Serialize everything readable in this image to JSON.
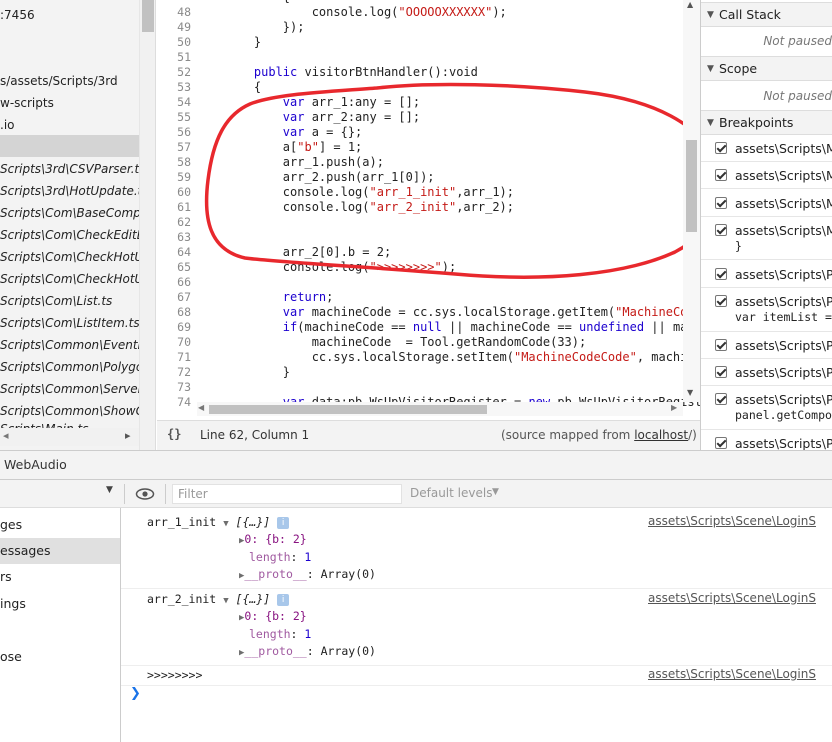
{
  "nav": {
    "rows": [
      ":7456",
      "",
      "",
      "s/assets/Scripts/3rd",
      "w-scripts",
      ".io",
      "",
      "Scripts\\3rd\\CSVParser.ts",
      "Scripts\\3rd\\HotUpdate.ts",
      "Scripts\\Com\\BaseCompo",
      "Scripts\\Com\\CheckEditBo",
      "Scripts\\Com\\CheckHotUp",
      "Scripts\\Com\\CheckHotUp",
      "Scripts\\Com\\List.ts",
      "Scripts\\Com\\ListItem.ts",
      "Scripts\\Common\\EventNo",
      "Scripts\\Common\\Polygor",
      "Scripts\\Common\\ServerC",
      "Scripts\\Common\\ShowGo",
      "Scripts\\Main.ts"
    ],
    "scroll_left_arrow": "◂",
    "scroll_right_arrow": "▸"
  },
  "editor": {
    "line_numbers": [
      "48",
      "49",
      "50",
      "51",
      "52",
      "53",
      "54",
      "55",
      "56",
      "57",
      "58",
      "59",
      "60",
      "61",
      "62",
      "63",
      "64",
      "65",
      "66",
      "67",
      "68",
      "69",
      "70",
      "71",
      "72",
      "73",
      "74"
    ],
    "status": {
      "braces": "{}",
      "position": "Line 62, Column 1",
      "source_prefix": "(source mapped from ",
      "source_link": "localhost",
      "source_suffix": "/)"
    }
  },
  "sidebar": {
    "call_stack": {
      "title": "Call Stack",
      "empty": "Not paused"
    },
    "scope": {
      "title": "Scope",
      "empty": "Not paused"
    },
    "breakpoints": {
      "title": "Breakpoints",
      "items": [
        {
          "label": "assets\\Scripts\\Ma",
          "sub": ""
        },
        {
          "label": "assets\\Scripts\\Ma",
          "sub": ""
        },
        {
          "label": "assets\\Scripts\\Ma",
          "sub": ""
        },
        {
          "label": "assets\\Scripts\\Ma",
          "sub": "}"
        },
        {
          "label": "assets\\Scripts\\Pa",
          "sub": ""
        },
        {
          "label": "assets\\Scripts\\Pa",
          "sub": "var itemList ="
        },
        {
          "label": "assets\\Scripts\\Pa",
          "sub": ""
        },
        {
          "label": "assets\\Scripts\\Pa",
          "sub": ""
        },
        {
          "label": "assets\\Scripts\\Pa",
          "sub": "panel.getCompo"
        },
        {
          "label": "assets\\Scripts\\Pa",
          "sub": ""
        }
      ]
    }
  },
  "tabbar": {
    "tab": "WebAudio"
  },
  "toolbar": {
    "filter_placeholder": "Filter",
    "levels": "Default levels"
  },
  "console_sidebar": {
    "items": [
      "ges",
      "essages",
      "rs",
      "ings",
      "",
      "ose"
    ]
  },
  "console": {
    "messages": [
      {
        "label": "arr_1_init",
        "obj": "[{…}]",
        "source": "assets\\Scripts\\Scene\\LoginS",
        "item0": "0: {b: 2}",
        "length_key": "length",
        "length_val": "1",
        "proto": "__proto__",
        "proto_val": "Array(0)"
      },
      {
        "label": "arr_2_init",
        "obj": "[{…}]",
        "source": "assets\\Scripts\\Scene\\LoginS",
        "item0": "0: {b: 2}",
        "length_key": "length",
        "length_val": "1",
        "proto": "__proto__",
        "proto_val": "Array(0)"
      },
      {
        "label": ">>>>>>>>",
        "source": "assets\\Scripts\\Scene\\LoginS"
      }
    ],
    "prompt": "❯"
  },
  "colors": {
    "annotation": "#e8282d",
    "prompt": "#1a73e8"
  }
}
